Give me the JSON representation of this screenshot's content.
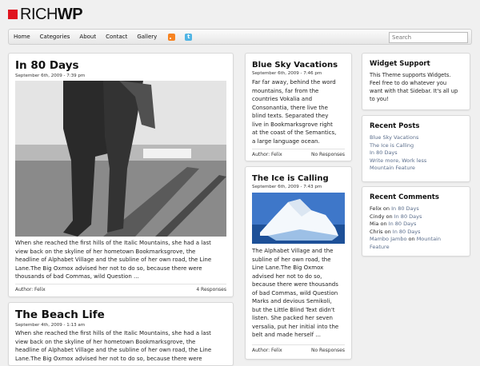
{
  "header": {
    "logo_light": "RICH",
    "logo_bold": "WP"
  },
  "nav": {
    "items": [
      "Home",
      "Categories",
      "About",
      "Contact",
      "Gallery"
    ],
    "search_placeholder": "Search"
  },
  "posts": [
    {
      "title": "In 80 Days",
      "date": "September 6th, 2009 - 7:39 pm",
      "lines": [
        "When she reached the first hills of the Italic Mountains, she had a last",
        "view back on the skyline of her hometown Bookmarksgrove, the",
        "headline of Alphabet Village and the subline of her own road, the Line",
        "Lane.The Big Oxmox advised her not to do so, because there were",
        "thousands of bad Commas, wild Question ..."
      ],
      "author": "Author: Felix",
      "responses": "4 Responses"
    },
    {
      "title": "The Beach Life",
      "date": "September 4th, 2009 - 1:13 am",
      "lines": [
        "When she reached the first hills of the Italic Mountains, she had a last",
        "view back on the skyline of her hometown Bookmarksgrove, the",
        "headline of Alphabet Village and the subline of her own road, the Line",
        "Lane.The Big Oxmox advised her not to do so, because there were"
      ]
    }
  ],
  "mid_posts": [
    {
      "title": "Blue Sky Vacations",
      "date": "September 6th, 2009 - 7:46 pm",
      "lines": [
        "Far far away, behind the word",
        "mountains, far from the",
        "countries Vokalia and",
        "Consonantia, there live the",
        "blind texts. Separated they",
        "live in Bookmarksgrove right",
        "at the coast of the Semantics,",
        "a large language ocean."
      ],
      "author": "Author: Felix",
      "responses": "No Responses"
    },
    {
      "title": "The Ice is Calling",
      "date": "September 6th, 2009 - 7:43 pm",
      "lines": [
        "The Alphabet Village and the",
        "subline of her own road, the",
        "Line Lane.The Big Oxmox",
        "advised her not to do so,",
        "because there were thousands",
        "of bad Commas, wild Question",
        "Marks and devious Semikoli,",
        "but the Little Blind Text didn't",
        "listen. She packed her seven",
        "versalia, put her initial into the",
        "belt and made herself ..."
      ],
      "author": "Author: Felix",
      "responses": "No Responses"
    }
  ],
  "widgets": {
    "support": {
      "title": "Widget Support",
      "lines": [
        "This Theme supports Widgets.",
        "Feel free to do whatever you",
        "want with that Sidebar. It's all up",
        "to you!"
      ]
    },
    "recent_posts": {
      "title": "Recent Posts",
      "items": [
        "Blue Sky Vacations",
        "The Ice is Calling",
        "In 80 Days",
        "Write more, Work less",
        "Mountain Feature"
      ]
    },
    "recent_comments": {
      "title": "Recent Comments",
      "on": "on",
      "items": [
        {
          "author": "Felix",
          "post": "In 80 Days"
        },
        {
          "author": "Cindy",
          "post": "In 80 Days"
        },
        {
          "author": "Mia",
          "post": "In 80 Days"
        },
        {
          "author": "Chris",
          "post": "In 80 Days"
        },
        {
          "author": "Mambo Jambo",
          "post": "Mountain",
          "post_cont": "Feature"
        }
      ]
    }
  }
}
